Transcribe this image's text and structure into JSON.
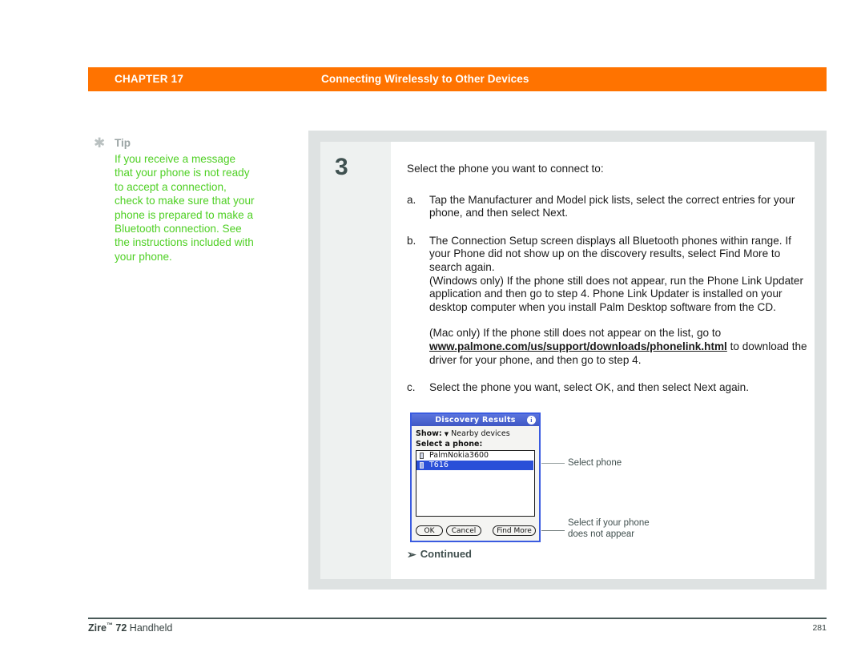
{
  "header": {
    "chapter_label": "CHAPTER",
    "chapter_number": "17",
    "title": "Connecting Wirelessly to Other Devices",
    "band_color": "#ff7300"
  },
  "tip": {
    "icon": "asterisk-icon",
    "label": "Tip",
    "body": "If you receive a message that your phone is not ready to accept a connection, check to make sure that your phone is prepared to make a Bluetooth connection. See the instructions included with your phone.",
    "text_color": "#4fd024"
  },
  "step": {
    "number": "3",
    "lead": "Select the phone you want to connect to:",
    "items": [
      {
        "mark": "a.",
        "text": "Tap the Manufacturer and Model pick lists, select the correct entries for your phone, and then select Next."
      },
      {
        "mark": "b.",
        "text": "The Connection Setup screen displays all Bluetooth phones within range. If your Phone did not show up on the discovery results, select Find More to search again.",
        "paragraphs": [
          "(Windows only) If the phone still does not appear, run the Phone Link Updater application and then go to step 4. Phone Link Updater is installed on your desktop computer when you install Palm Desktop software from the CD."
        ],
        "mac_paragraph": {
          "before": "(Mac only) If the phone still does not appear on the list, go to ",
          "url": "www.palmone.com/us/support/downloads/phonelink.html",
          "after": " to download the driver for your phone, and then go to step 4."
        }
      },
      {
        "mark": "c.",
        "text": "Select the phone you want, select OK, and then select Next again."
      }
    ],
    "continued_label": "Continued",
    "continued_icon": "arrow-down-right-icon"
  },
  "device": {
    "title": "Discovery Results",
    "title_icon": "info-icon",
    "show_label": "Show:",
    "show_caret_icon": "caret-down-icon",
    "show_value": "Nearby devices",
    "select_label": "Select a phone:",
    "list": [
      {
        "name": "PalmNokia3600",
        "selected": false,
        "icon": "device-icon"
      },
      {
        "name": "T616",
        "selected": true,
        "icon": "device-icon"
      }
    ],
    "buttons": [
      {
        "label": "OK"
      },
      {
        "label": "Cancel"
      },
      {
        "label": "Find More"
      }
    ],
    "title_bar_color": "#4a63cf",
    "selection_color": "#2a4fd8"
  },
  "callouts": [
    {
      "text": "Select phone"
    },
    {
      "text": "Select if your phone\ndoes not appear"
    }
  ],
  "callout_texts": {
    "select_phone": "Select phone",
    "find_more_line1": "Select if your phone",
    "find_more_line2": "does not appear"
  },
  "footer": {
    "product": "Zire",
    "trademark": "™",
    "model": " 72",
    "suffix": " Handheld",
    "page_number": "281"
  }
}
